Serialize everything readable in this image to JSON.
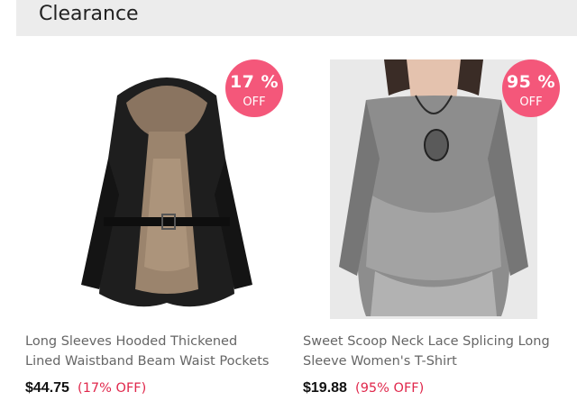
{
  "section": {
    "title": "Clearance"
  },
  "products": [
    {
      "title_lines": [
        "Long Sleeves Hooded Thickened",
        "Lined Waistband Beam Waist Pockets"
      ],
      "price": "$44.75",
      "discount": "(17% OFF)",
      "badge": {
        "percent": "17 %",
        "off": "OFF"
      },
      "image_icon": "hooded-fur-lined-coat"
    },
    {
      "title_lines": [
        "Sweet Scoop Neck Lace Splicing Long",
        "Sleeve Women's T-Shirt"
      ],
      "price": "$19.88",
      "discount": "(95% OFF)",
      "badge": {
        "percent": "95 %",
        "off": "OFF"
      },
      "image_icon": "grey-lace-tshirt"
    }
  ],
  "colors": {
    "badge": "#f4577a",
    "discount_text": "#e0284c",
    "header_bg": "#ececec",
    "title_text": "#666666"
  }
}
